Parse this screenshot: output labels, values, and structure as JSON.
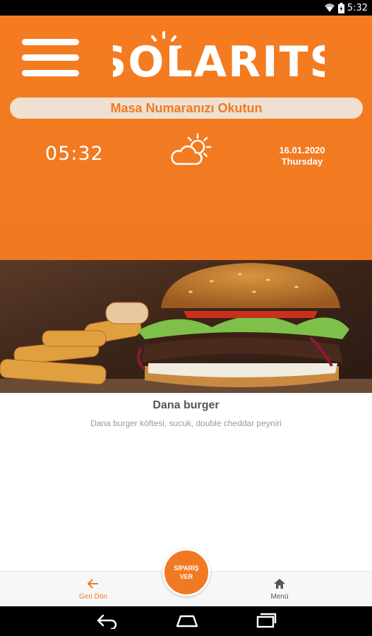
{
  "status_bar": {
    "time": "5:32"
  },
  "header": {
    "logo_text": "SOLARITS",
    "scan_table_label": "Masa Numaranızı Okutun",
    "clock": "05:32",
    "weather_icon": "partly-sunny-icon",
    "date": "16.01.2020",
    "day": "Thursday",
    "accent_color": "#f47b20"
  },
  "product": {
    "name": "Dana burger",
    "description": "Dana burger köftesi, sucuk, double cheddar peyniri"
  },
  "bottom_nav": {
    "back_label": "Geri Dön",
    "order_label": "SİPARİŞ VER",
    "menu_label": "Menü"
  }
}
